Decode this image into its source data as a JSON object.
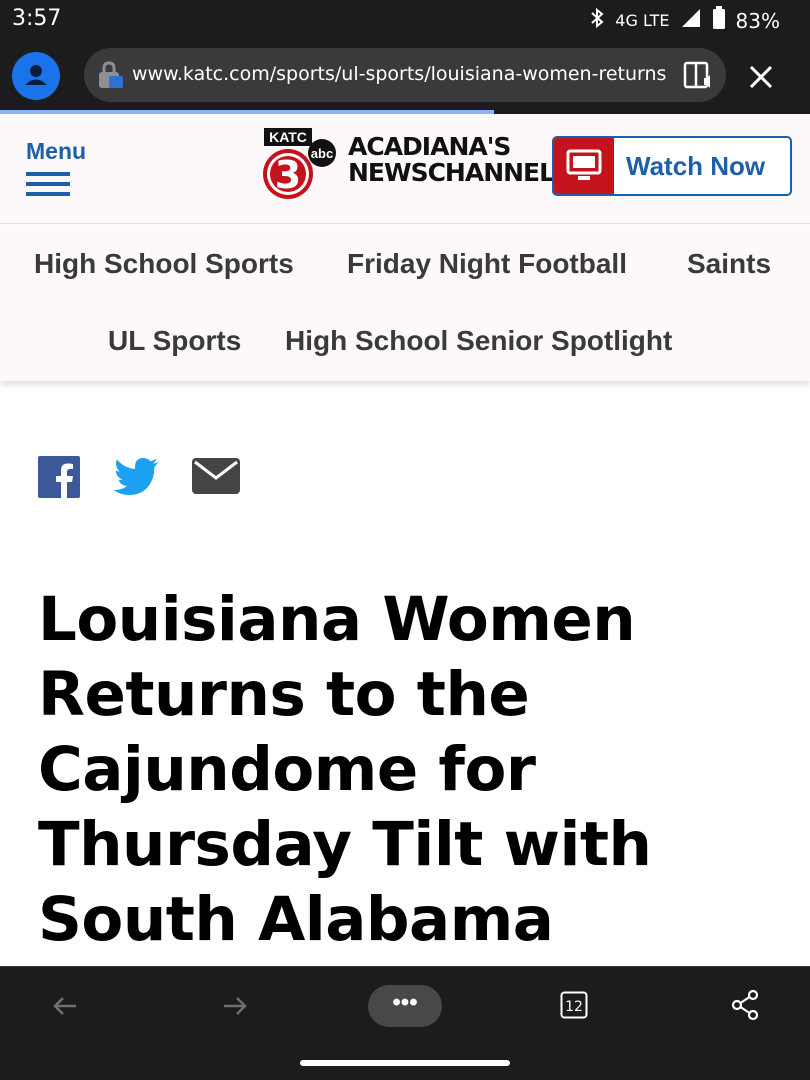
{
  "status_bar": {
    "time": "3:57",
    "network": "4G LTE",
    "battery": "83%"
  },
  "browser": {
    "url": "www.katc.com/sports/ul-sports/louisiana-women-returns",
    "load_progress": 0.61,
    "tab_count": "12",
    "more_label": "•••"
  },
  "header": {
    "menu_label": "Menu",
    "logo_station": "KATC",
    "logo_channel": "3",
    "logo_network": "abc",
    "logo_tagline_1": "ACADIANA'S",
    "logo_tagline_2": "NEWSCHANNEL",
    "watch_now_label": "Watch Now"
  },
  "nav": {
    "items": [
      "High School Sports",
      "Friday Night Football",
      "Saints",
      "UL Sports",
      "High School Senior Spotlight"
    ]
  },
  "article": {
    "headline": "Louisiana Women Returns to the Cajundome for Thursday Tilt with South Alabama"
  },
  "colors": {
    "brand_blue": "#1d5fa8",
    "brand_red": "#c4131d",
    "facebook": "#3b5998",
    "twitter": "#1da1f2",
    "email": "#444444"
  }
}
